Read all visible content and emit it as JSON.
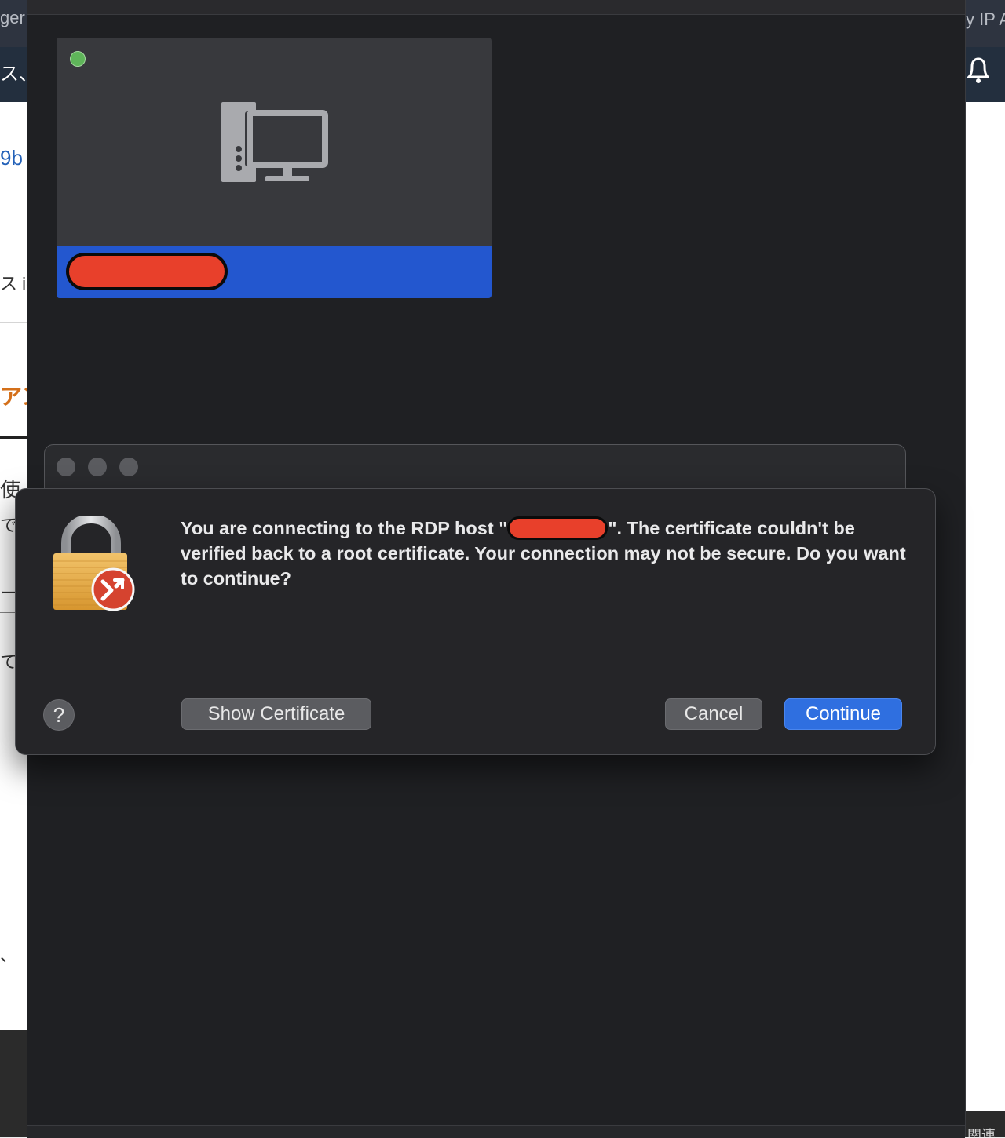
{
  "background_left": {
    "fragments": [
      "ger",
      "ス、",
      "9b",
      "ス i-",
      "アン",
      "使",
      "で",
      "ー",
      "て",
      "、"
    ]
  },
  "background_right": {
    "fragments": [
      "y IP A",
      "関連"
    ]
  },
  "colors": {
    "window_bg": "#1f2023",
    "tile_bg": "#38393d",
    "selection_blue": "#2357cf",
    "status_green": "#5fb55a",
    "redaction_red": "#e8402b",
    "primary_button": "#2f6fe0"
  },
  "pc_tile": {
    "status": "online",
    "icon": "desktop-pc-icon"
  },
  "dialog": {
    "icon": "lock-rdp-icon",
    "message_before": "You are connecting to the RDP host \"",
    "message_after": "\". The certificate couldn't be verified back to a root certificate. Your connection may not be secure. Do you want to continue?",
    "help_label": "?",
    "show_certificate_label": "Show Certificate",
    "cancel_label": "Cancel",
    "continue_label": "Continue"
  }
}
